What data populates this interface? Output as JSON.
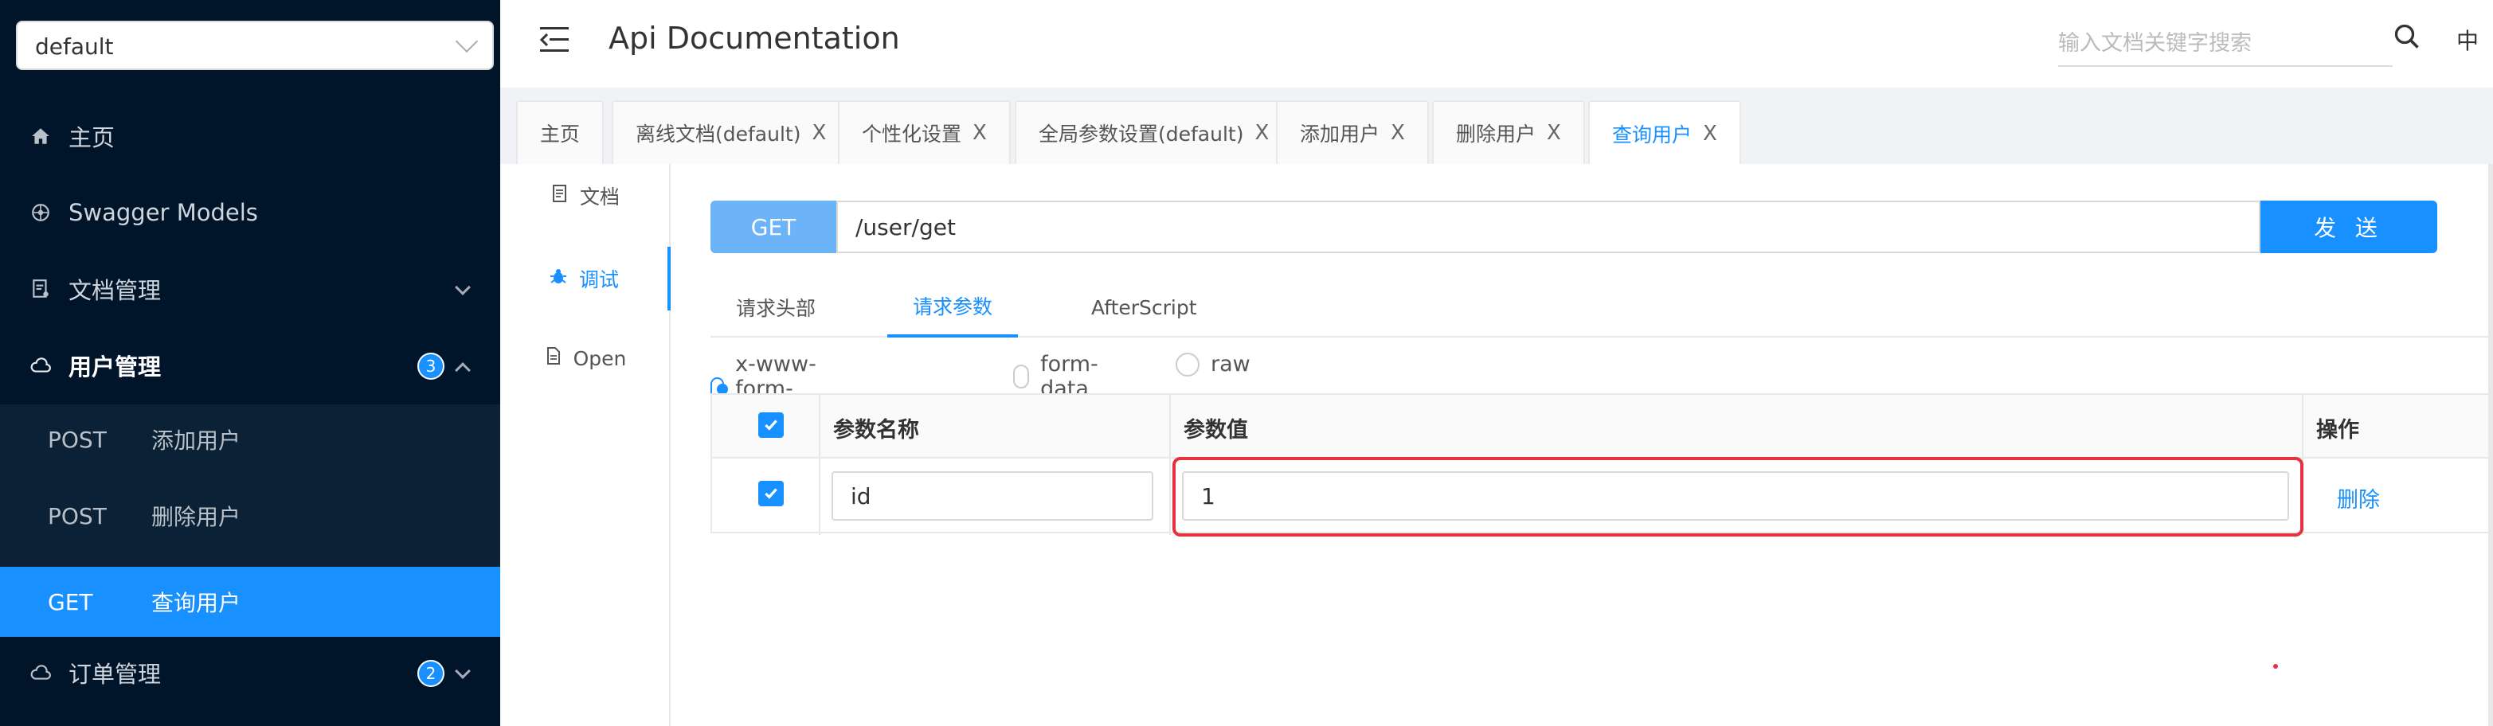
{
  "sidebar": {
    "group_select": "default",
    "menu": [
      {
        "label": "主页",
        "icon": "home-icon"
      },
      {
        "label": "Swagger Models",
        "icon": "models-icon"
      },
      {
        "label": "文档管理",
        "icon": "doc-manage-icon"
      },
      {
        "label": "用户管理",
        "icon": "cloud-icon",
        "badge": "3"
      },
      {
        "label": "订单管理",
        "icon": "cloud-icon",
        "badge": "2"
      }
    ],
    "submenu": [
      {
        "method": "POST",
        "name": "添加用户"
      },
      {
        "method": "POST",
        "name": "删除用户"
      },
      {
        "method": "GET",
        "name": "查询用户"
      }
    ]
  },
  "header": {
    "title": "Api Documentation",
    "search_placeholder": "输入文档关键字搜索",
    "lang": "中"
  },
  "tabs": [
    {
      "label": "主页",
      "closable": false
    },
    {
      "label": "离线文档(default)",
      "closable": true
    },
    {
      "label": "个性化设置",
      "closable": true
    },
    {
      "label": "全局参数设置(default)",
      "closable": true
    },
    {
      "label": "添加用户",
      "closable": true
    },
    {
      "label": "删除用户",
      "closable": true
    },
    {
      "label": "查询用户",
      "closable": true
    }
  ],
  "tab_close_glyph": "X",
  "side_tabs": [
    {
      "label": "文档"
    },
    {
      "label": "调试"
    },
    {
      "label": "Open"
    }
  ],
  "request": {
    "method": "GET",
    "url": "/user/get",
    "send_label": "发 送",
    "tabs": [
      "请求头部",
      "请求参数",
      "AfterScript"
    ],
    "body_types": [
      "x-www-form-urlencoded",
      "form-data",
      "raw"
    ],
    "columns": [
      "参数名称",
      "参数值",
      "操作"
    ],
    "params": [
      {
        "name": "id",
        "value": "1",
        "action": "删除"
      }
    ]
  },
  "colors": {
    "accent": "#1890ff",
    "sidebar_bg": "#001529",
    "highlight": "#e5323e"
  }
}
